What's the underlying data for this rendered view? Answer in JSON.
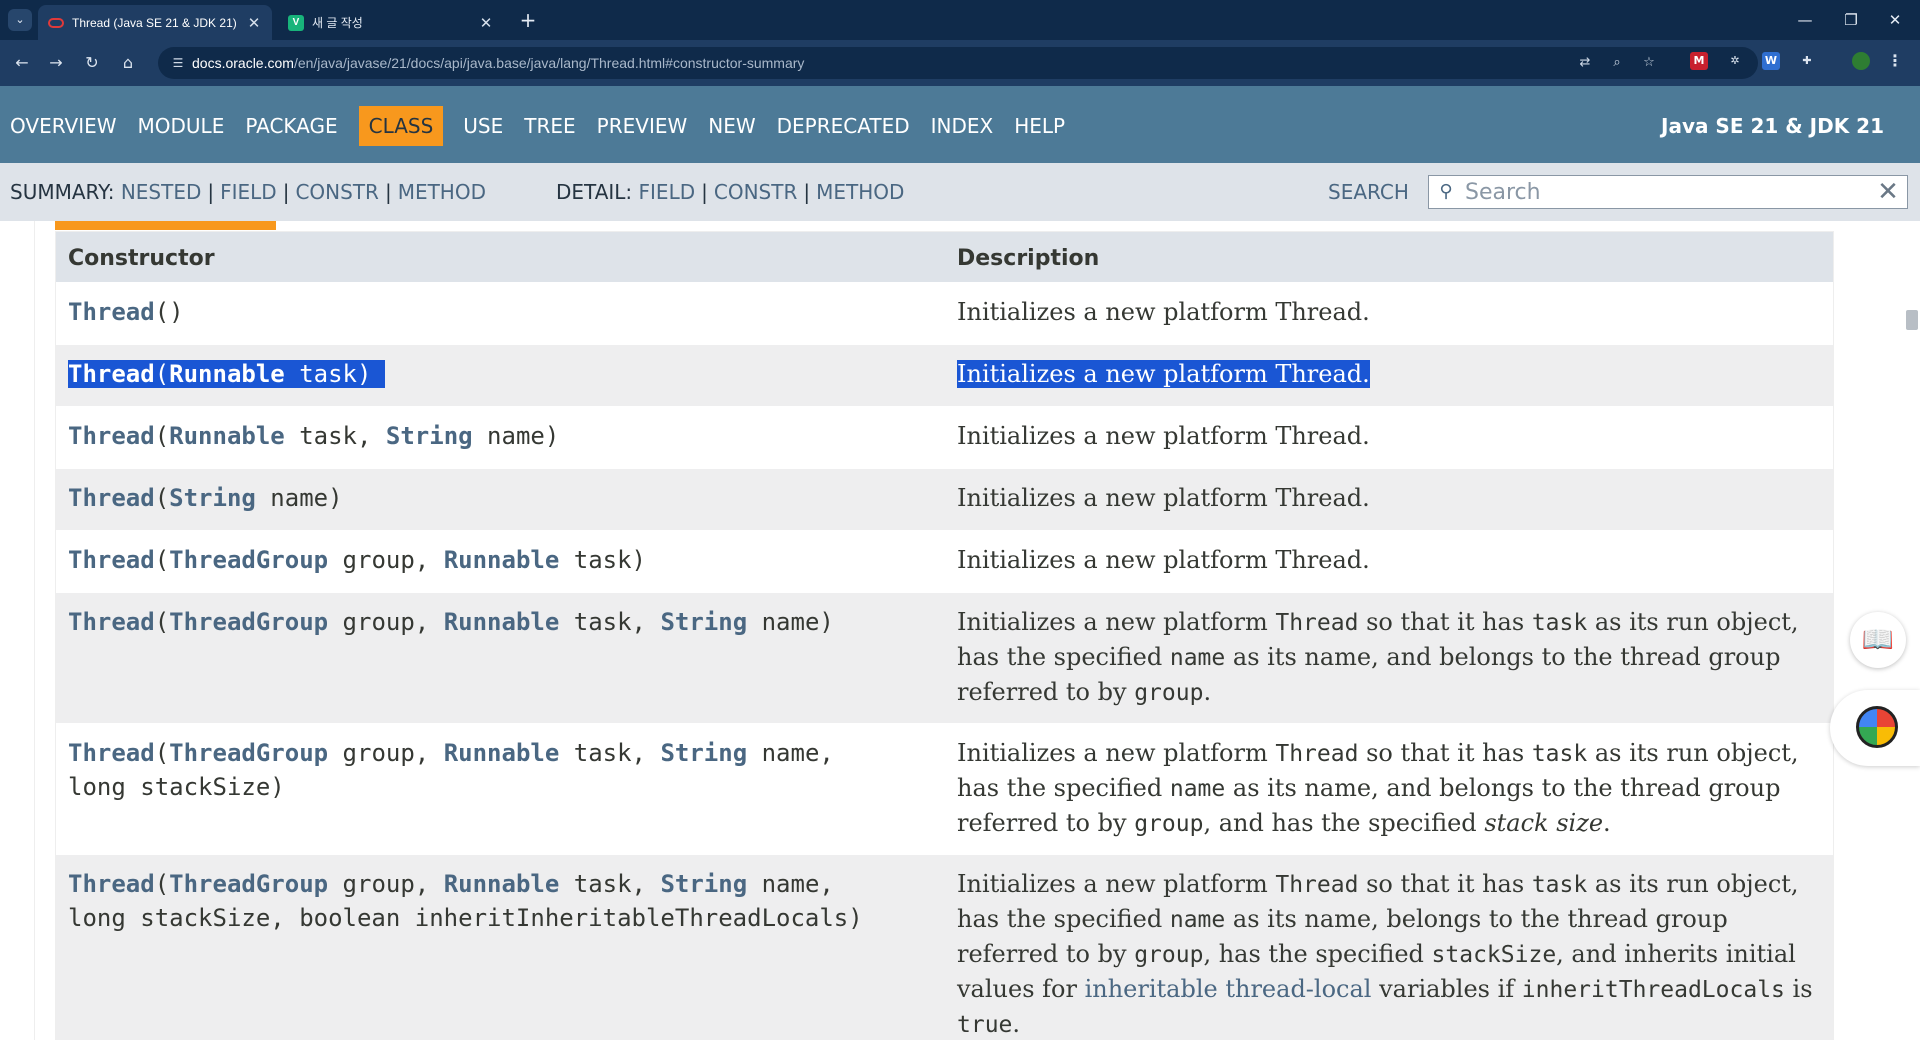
{
  "browser": {
    "tabs": [
      {
        "title": "Thread (Java SE 21 & JDK 21)",
        "active": true
      },
      {
        "title": "새 글 작성",
        "active": false
      }
    ],
    "new_tab": "+",
    "window_controls": {
      "minimize": "—",
      "restore": "❐",
      "close": "✕"
    },
    "url_host": "docs.oracle.com",
    "url_path": "/en/java/javase/21/docs/api/java.base/java/lang/Thread.html#constructor-summary",
    "icons": {
      "back": "←",
      "forward": "→",
      "reload": "↻",
      "home": "⌂",
      "site_info": "☰",
      "translate": "⇄",
      "zoom": "⌕",
      "bookmark": "☆",
      "tab_search": "⌄",
      "reset": "✕",
      "search": "⚲",
      "reader": "📖",
      "menu": "⋮"
    },
    "extensions": [
      "M",
      "✲",
      "W",
      "✚"
    ]
  },
  "topnav": {
    "items": [
      "OVERVIEW",
      "MODULE",
      "PACKAGE",
      "CLASS",
      "USE",
      "TREE",
      "PREVIEW",
      "NEW",
      "DEPRECATED",
      "INDEX",
      "HELP"
    ],
    "current": "CLASS",
    "about": "Java SE 21 & JDK 21"
  },
  "subnav": {
    "summary_label": "SUMMARY:",
    "summary_links": [
      "NESTED",
      "FIELD",
      "CONSTR",
      "METHOD"
    ],
    "detail_label": "DETAIL:",
    "detail_links": [
      "FIELD",
      "CONSTR",
      "METHOD"
    ],
    "search_label": "SEARCH",
    "search_placeholder": "Search"
  },
  "table": {
    "headers": [
      "Constructor",
      "Description"
    ],
    "rows": [
      {
        "sig": "Thread()",
        "desc": "Initializes a new platform Thread."
      },
      {
        "sig": "Thread(Runnable task)",
        "desc": "Initializes a new platform Thread.",
        "selected": true
      },
      {
        "sig": "Thread(Runnable task, String name)",
        "desc": "Initializes a new platform Thread."
      },
      {
        "sig": "Thread(String name)",
        "desc": "Initializes a new platform Thread."
      },
      {
        "sig": "Thread(ThreadGroup group, Runnable task)",
        "desc": "Initializes a new platform Thread."
      },
      {
        "sig": "Thread(ThreadGroup group, Runnable task, String name)",
        "desc": "Initializes a new platform Thread so that it has task as its run object, has the specified name as its name, and belongs to the thread group referred to by group."
      },
      {
        "sig": "Thread(ThreadGroup group, Runnable task, String name, long stackSize)",
        "desc": "Initializes a new platform Thread so that it has task as its run object, has the specified name as its name, and belongs to the thread group referred to by group, and has the specified stack size."
      },
      {
        "sig": "Thread(ThreadGroup group, Runnable task, String name, long stackSize, boolean inheritInheritableThreadLocals)",
        "desc": "Initializes a new platform Thread so that it has task as its run object, has the specified name as its name, belongs to the thread group referred to by group, has the specified stackSize, and inherits initial values for inheritable thread-local variables if inheritThreadLocals is true."
      }
    ]
  },
  "colors": {
    "header_bg": "#4d7a97",
    "current_tab": "#f8981d",
    "subnav_bg": "#dee3e9",
    "link": "#4a6782",
    "selection": "#1a56d4"
  }
}
